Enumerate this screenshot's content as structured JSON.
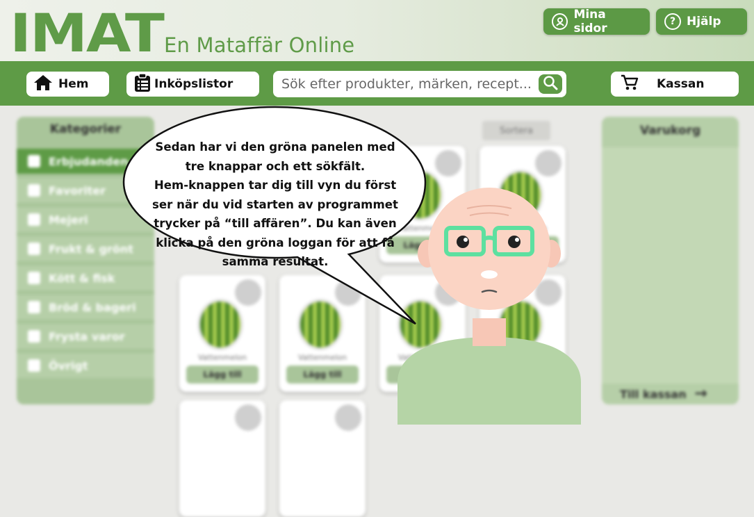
{
  "header": {
    "logo_text": "IMAT",
    "tagline": "En Mataffär Online",
    "my_pages_label": "Mina sidor",
    "help_label": "Hjälp",
    "help_icon_glyph": "?"
  },
  "navbar": {
    "home_label": "Hem",
    "lists_label": "Inköpslistor",
    "search_placeholder": "Sök efter produkter, märken, recept...",
    "checkout_label": "Kassan"
  },
  "categories": {
    "title": "Kategorier",
    "items": [
      {
        "label": "Erbjudanden",
        "checked": true
      },
      {
        "label": "Favoriter",
        "checked": false
      },
      {
        "label": "Mejeri",
        "checked": false
      },
      {
        "label": "Frukt & grönt",
        "checked": false
      },
      {
        "label": "Kött & fisk",
        "checked": false
      },
      {
        "label": "Bröd & bageri",
        "checked": false
      },
      {
        "label": "Frysta varor",
        "checked": false
      },
      {
        "label": "Övrigt",
        "checked": false
      }
    ]
  },
  "products": {
    "sort_label": "Sortera",
    "item_name": "Vattenmelon",
    "add_label": "Lägg till"
  },
  "cart": {
    "title": "Varukorg",
    "checkout_label": "Till kassan"
  },
  "speech_bubble": {
    "lines": [
      "Sedan har vi den gröna panelen med",
      "tre knappar och ett sökfält.",
      "Hem-knappen tar dig till vyn du först",
      "ser när du vid starten av programmet",
      "trycker på “till affären”. Du kan även",
      "klicka på den gröna loggan för att få",
      "samma resultat."
    ]
  },
  "colors": {
    "primary_green": "#5e9b46",
    "light_green": "#b6cfa8",
    "glasses": "#5de0a0"
  }
}
